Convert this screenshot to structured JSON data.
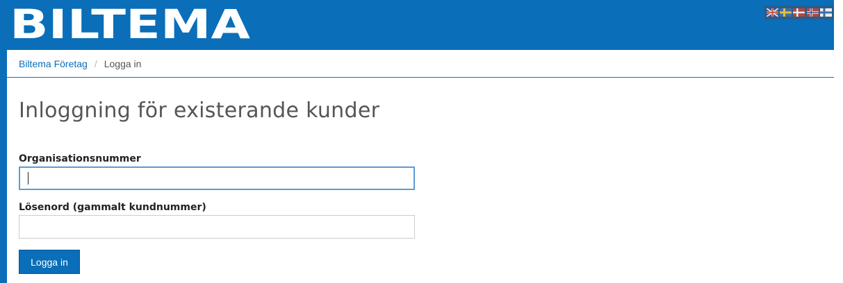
{
  "header": {
    "logo_text": "BILTEMA",
    "brand_color": "#0a6eb8",
    "language_flags": [
      {
        "name": "english-flag-icon"
      },
      {
        "name": "swedish-flag-icon"
      },
      {
        "name": "danish-flag-icon"
      },
      {
        "name": "norwegian-flag-icon"
      },
      {
        "name": "finnish-flag-icon"
      }
    ]
  },
  "breadcrumb": {
    "home": "Biltema Företag",
    "separator": "/",
    "current": "Logga in"
  },
  "main": {
    "title": "Inloggning för existerande kunder",
    "org_label": "Organisationsnummer",
    "org_value": "",
    "org_placeholder": "",
    "password_label": "Lösenord (gammalt kundnummer)",
    "password_value": "",
    "password_placeholder": "",
    "login_button": "Logga in"
  }
}
